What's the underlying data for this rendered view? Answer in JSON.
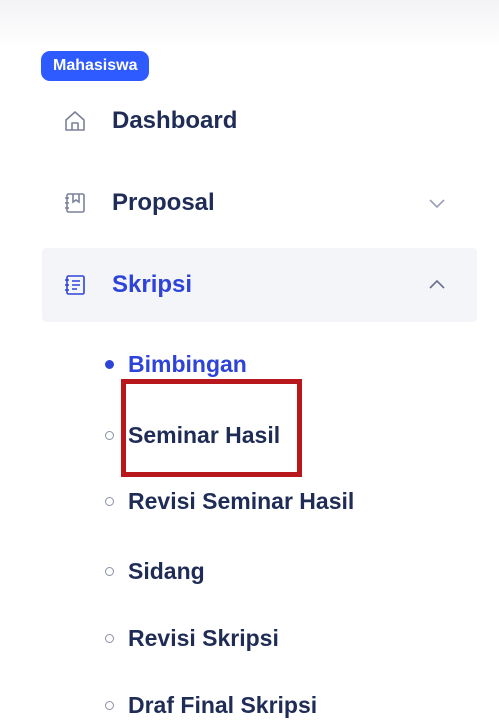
{
  "sidebar": {
    "section_label": "Mahasiswa",
    "items": [
      {
        "label": "Dashboard",
        "icon": "home-icon"
      },
      {
        "label": "Proposal",
        "icon": "book-icon",
        "chevron": "chevron-down-icon"
      },
      {
        "label": "Skripsi",
        "icon": "notes-icon",
        "chevron": "chevron-up-icon",
        "active": true
      }
    ],
    "submenu": [
      {
        "label": "Bimbingan",
        "active": true
      },
      {
        "label": "Seminar Hasil"
      },
      {
        "label": "Revisi Seminar Hasil"
      },
      {
        "label": "Sidang"
      },
      {
        "label": "Revisi Skripsi"
      },
      {
        "label": "Draf Final Skripsi"
      }
    ]
  },
  "colors": {
    "accent": "#2e44d8",
    "badge": "#2e5bff",
    "text": "#1f2c56",
    "highlight": "#b8171b"
  }
}
